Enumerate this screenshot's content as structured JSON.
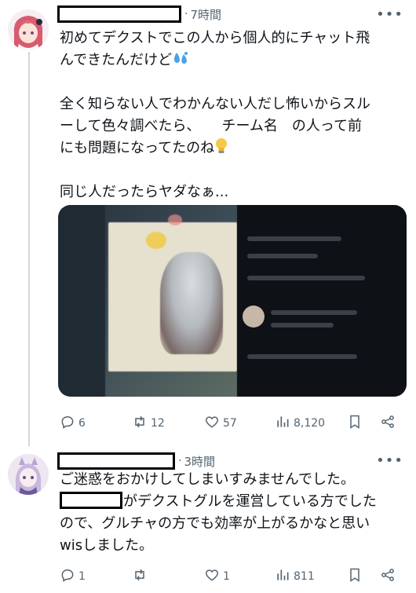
{
  "tweet1": {
    "time": "7時間",
    "lines": [
      "初めてデクストでこの人から個人的にチャット飛",
      "んできたんだけど",
      "",
      "全く知らない人でわかんない人だし怖いからスル",
      "ーして色々調べたら、　　チーム名　の人って前",
      "にも問題になってたのね",
      "",
      "同じ人だったらヤダなぁ..."
    ],
    "stats": {
      "replies": "6",
      "retweets": "12",
      "likes": "57",
      "views": "8,120"
    }
  },
  "tweet2": {
    "time": "3時間",
    "lines": [
      "ご迷惑をおかけしてしまいすみませんでした。",
      "がデクストグルを運営している方でした",
      "ので、グルチャの方でも効率が上がるかなと思い",
      "wisしました。"
    ],
    "stats": {
      "replies": "1",
      "retweets": "",
      "likes": "1",
      "views": "811"
    }
  },
  "icons": {
    "reply": "reply-icon",
    "retweet": "retweet-icon",
    "like": "heart-icon",
    "views": "views-icon",
    "bookmark": "bookmark-icon",
    "share": "share-icon",
    "more": "more-icon"
  },
  "colors": {
    "secondary_text": "#536471",
    "thread_line": "#cfd9de"
  }
}
